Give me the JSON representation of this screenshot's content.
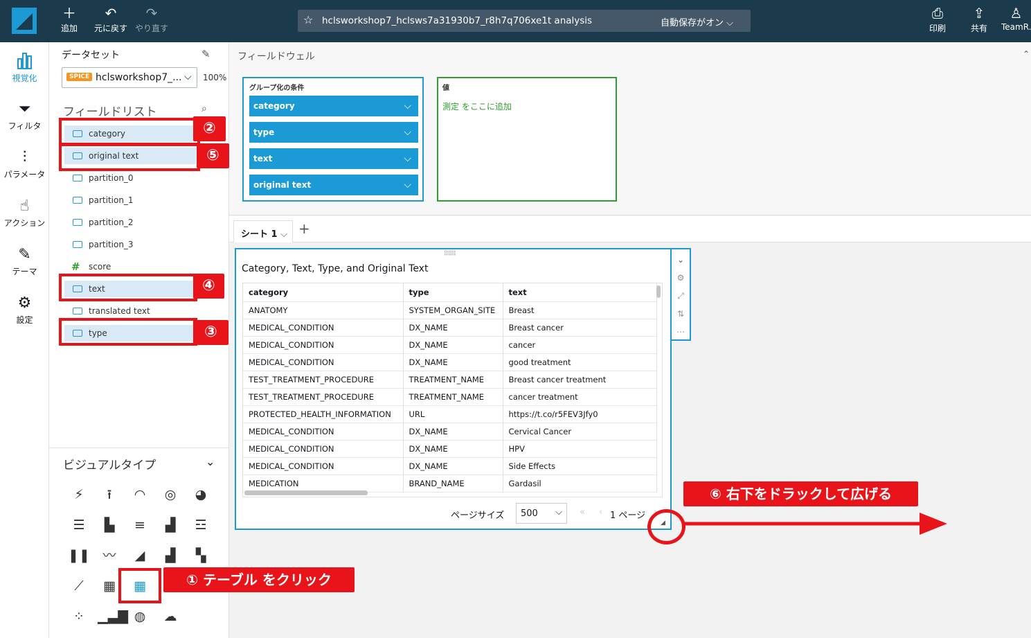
{
  "topbar": {
    "add": "追加",
    "undo": "元に戻す",
    "redo": "やり直す",
    "analysis_title": "hclsworkshop7_hclsws7a31930b7_r8h7q706xe1t analysis",
    "autosave": "自動保存がオン",
    "print": "印刷",
    "share": "共有",
    "user": "TeamR."
  },
  "leftnav": [
    {
      "label": "視覚化",
      "icon": "bar-chart-icon"
    },
    {
      "label": "フィルタ",
      "icon": "filter-icon"
    },
    {
      "label": "パラメータ",
      "icon": "sliders-icon"
    },
    {
      "label": "アクション",
      "icon": "pointer-gear-icon"
    },
    {
      "label": "テーマ",
      "icon": "brush-icon"
    },
    {
      "label": "設定",
      "icon": "gear-icon"
    }
  ],
  "dataset": {
    "header": "データセット",
    "badge": "SPICE",
    "name": "hclsworkshop7_...",
    "percent": "100%"
  },
  "fieldlist": {
    "header": "フィールドリスト",
    "fields": [
      {
        "name": "category",
        "type": "dimension"
      },
      {
        "name": "original text",
        "type": "dimension"
      },
      {
        "name": "partition_0",
        "type": "dimension"
      },
      {
        "name": "partition_1",
        "type": "dimension"
      },
      {
        "name": "partition_2",
        "type": "dimension"
      },
      {
        "name": "partition_3",
        "type": "dimension"
      },
      {
        "name": "score",
        "type": "measure"
      },
      {
        "name": "text",
        "type": "dimension"
      },
      {
        "name": "translated text",
        "type": "dimension"
      },
      {
        "name": "type",
        "type": "dimension"
      }
    ]
  },
  "annotations": {
    "n1": "① テーブル をクリック",
    "n2": "②",
    "n3": "③",
    "n4": "④",
    "n5": "⑤",
    "n6": "⑥ 右下をドラックして広げる"
  },
  "visualtypes": {
    "header": "ビジュアルタイプ"
  },
  "fieldwell": {
    "header": "フィールドウェル",
    "group_by_label": "グループ化の条件",
    "group_by": [
      "category",
      "type",
      "text",
      "original text"
    ],
    "value_label": "値",
    "value_placeholder": "測定 をここに追加"
  },
  "sheets": {
    "tab": "シート 1",
    "add": "+"
  },
  "visual": {
    "title": "Category, Text, Type, and Original Text",
    "columns": [
      "category",
      "type",
      "text"
    ],
    "rows": [
      [
        "ANATOMY",
        "SYSTEM_ORGAN_SITE",
        "Breast"
      ],
      [
        "MEDICAL_CONDITION",
        "DX_NAME",
        "Breast cancer"
      ],
      [
        "MEDICAL_CONDITION",
        "DX_NAME",
        "cancer"
      ],
      [
        "MEDICAL_CONDITION",
        "DX_NAME",
        "good treatment"
      ],
      [
        "TEST_TREATMENT_PROCEDURE",
        "TREATMENT_NAME",
        "Breast cancer treatment"
      ],
      [
        "TEST_TREATMENT_PROCEDURE",
        "TREATMENT_NAME",
        "cancer treatment"
      ],
      [
        "PROTECTED_HEALTH_INFORMATION",
        "URL",
        "https://t.co/r5FEV3Jfy0"
      ],
      [
        "MEDICAL_CONDITION",
        "DX_NAME",
        "Cervical Cancer"
      ],
      [
        "MEDICAL_CONDITION",
        "DX_NAME",
        "HPV"
      ],
      [
        "MEDICAL_CONDITION",
        "DX_NAME",
        "Side Effects"
      ],
      [
        "MEDICATION",
        "BRAND_NAME",
        "Gardasil"
      ]
    ],
    "page_size_label": "ページサイズ",
    "page_size": "500",
    "page_label": "1 ページ"
  },
  "colors": {
    "topbar": "#1b3a4b",
    "accent": "#1c9ad6",
    "annotation_red": "#e8141a",
    "value_well": "#2ea02e",
    "spice": "#f7931e"
  }
}
